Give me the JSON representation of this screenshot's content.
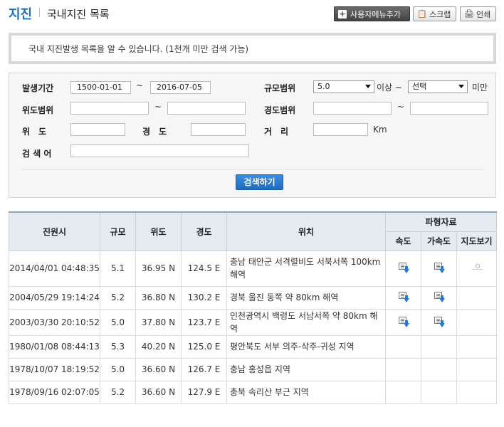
{
  "header": {
    "title": "지진",
    "subtitle": "국내지진 목록",
    "buttons": {
      "add_menu": "사용자메뉴추가",
      "scrap": "스크랩",
      "print": "인쇄"
    }
  },
  "info_text": "국내 지진발생 목록을 알 수 있습니다. (1천개 미만 검색 가능)",
  "search": {
    "period_label": "발생기간",
    "date_from": "1500-01-01",
    "date_to": "2016-07-05",
    "tilde": "~",
    "magnitude_label": "규모범위",
    "magnitude_min": "5.0",
    "magnitude_over": "이상 ~",
    "magnitude_max": "선택",
    "magnitude_under": "미만",
    "lat_range_label": "위도범위",
    "lon_range_label": "경도범위",
    "lat_label": "위　도",
    "lon_label": "경　도",
    "distance_label": "거　리",
    "distance_unit": "Km",
    "keyword_label": "검 색 어",
    "submit": "검색하기"
  },
  "table": {
    "headers": {
      "time": "진원시",
      "mag": "규모",
      "lat": "위도",
      "lon": "경도",
      "loc": "위치",
      "wave": "파형자료",
      "vel": "속도",
      "acc": "가속도",
      "map": "지도보기"
    },
    "rows": [
      {
        "time": "2014/04/01 04:48:35",
        "mag": "5.1",
        "lat": "36.95 N",
        "lon": "124.5 E",
        "loc": "충남 태안군 서격렬비도 서북서쪽 100km 해역",
        "vel": true,
        "acc": true,
        "map": true
      },
      {
        "time": "2004/05/29 19:14:24",
        "mag": "5.2",
        "lat": "36.80 N",
        "lon": "130.2 E",
        "loc": "경북 울진 동쪽 약 80km 해역",
        "vel": true,
        "acc": true,
        "map": false
      },
      {
        "time": "2003/03/30 20:10:52",
        "mag": "5.0",
        "lat": "37.80 N",
        "lon": "123.7 E",
        "loc": "인천광역시 백령도 서남서쪽 약 80km 해역",
        "vel": true,
        "acc": true,
        "map": false
      },
      {
        "time": "1980/01/08 08:44:13",
        "mag": "5.3",
        "lat": "40.20 N",
        "lon": "125.0 E",
        "loc": "평안북도 서부 의주-삭주-귀성 지역",
        "vel": false,
        "acc": false,
        "map": false
      },
      {
        "time": "1978/10/07 18:19:52",
        "mag": "5.0",
        "lat": "36.60 N",
        "lon": "126.7 E",
        "loc": "충남 홍성읍 지역",
        "vel": false,
        "acc": false,
        "map": false
      },
      {
        "time": "1978/09/16 02:07:05",
        "mag": "5.2",
        "lat": "36.60 N",
        "lon": "127.9 E",
        "loc": "충북 속리산 부근 지역",
        "vel": false,
        "acc": false,
        "map": false
      }
    ]
  },
  "colors": {
    "title": "#1a6fc4",
    "header_bg": "#e4ebf1",
    "search_button": "#1e6cc0"
  }
}
